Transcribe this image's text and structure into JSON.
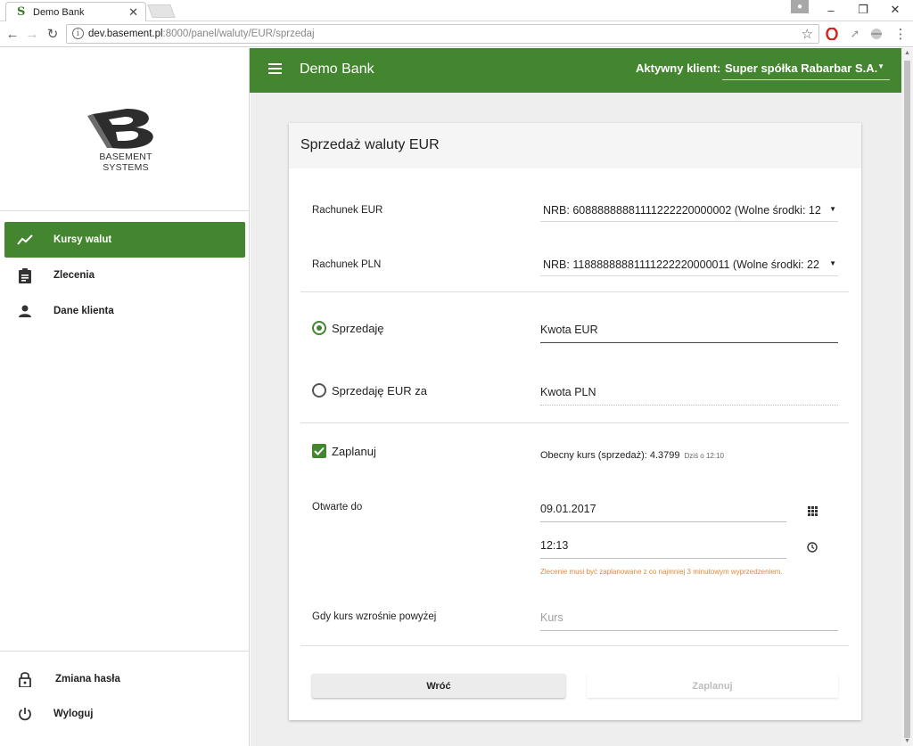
{
  "browser": {
    "tab_title": "Demo Bank",
    "tab_favicon": "S",
    "url_host": "dev.basement.pl",
    "url_rest": ":8000/panel/waluty/EUR/sprzedaj"
  },
  "sidebar": {
    "logo_text": "BASEMENT SYSTEMS",
    "items": [
      {
        "label": "Kursy walut",
        "icon": "trending-up-icon",
        "active": true
      },
      {
        "label": "Zlecenia",
        "icon": "clipboard-icon",
        "active": false
      },
      {
        "label": "Dane klienta",
        "icon": "person-icon",
        "active": false
      }
    ],
    "bottom_items": [
      {
        "label": "Zmiana hasła",
        "icon": "lock-icon"
      },
      {
        "label": "Wyloguj",
        "icon": "power-icon"
      }
    ]
  },
  "appbar": {
    "title": "Demo Bank",
    "client_label": "Aktywny klient:",
    "client_value": "Super spółka Rabarbar S.A."
  },
  "form": {
    "title": "Sprzedaż waluty EUR",
    "account_eur_label": "Rachunek EUR",
    "account_eur_value": "NRB: 60888888881111222220000002 (Wolne środki: 12",
    "account_pln_label": "Rachunek PLN",
    "account_pln_value": "NRB: 11888888881111222220000011 (Wolne środki: 22",
    "radio_sell": "Sprzedaję",
    "radio_sell_for": "Sprzedaję EUR za",
    "amount_eur": "Kwota EUR",
    "amount_pln": "Kwota PLN",
    "schedule_label": "Zaplanuj",
    "schedule_checked": true,
    "rate_text": "Obecny kurs (sprzedaż): 4.3799",
    "rate_stamp": "Dziś o 12:10",
    "open_until_label": "Otwarte do",
    "date_value": "09.01.2017",
    "time_value": "12:13",
    "warning": "Zlecenie musi być zaplanowane z co najmniej 3 minutowym wyprzedzeniem.",
    "rate_condition_label": "Gdy kurs wzrośnie powyżej",
    "rate_placeholder": "Kurs",
    "back_button": "Wróć",
    "plan_button": "Zaplanuj"
  },
  "colors": {
    "primary": "#43862f",
    "warning": "#e08a3a"
  }
}
